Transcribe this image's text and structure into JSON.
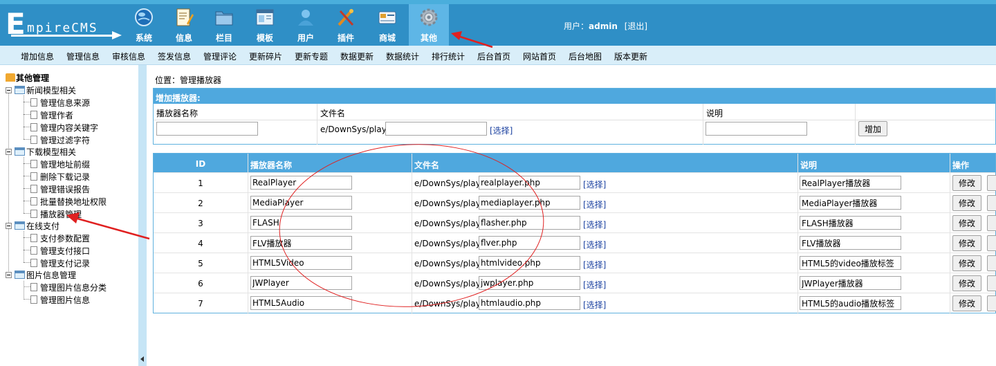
{
  "logo": {
    "first_letter": "E",
    "rest": "mpireCMS"
  },
  "nav": [
    {
      "label": "系统",
      "icon": "globe-icon"
    },
    {
      "label": "信息",
      "icon": "document-edit-icon"
    },
    {
      "label": "栏目",
      "icon": "folder-icon"
    },
    {
      "label": "模板",
      "icon": "window-icon"
    },
    {
      "label": "用户",
      "icon": "user-icon"
    },
    {
      "label": "插件",
      "icon": "tools-icon"
    },
    {
      "label": "商城",
      "icon": "card-icon"
    },
    {
      "label": "其他",
      "icon": "gear-icon",
      "active": true
    }
  ],
  "user": {
    "prefix": "用户：",
    "name": "admin",
    "logout": "[退出]"
  },
  "submenu": [
    "增加信息",
    "管理信息",
    "审核信息",
    "签发信息",
    "管理评论",
    "更新碎片",
    "更新专题",
    "数据更新",
    "数据统计",
    "排行统计",
    "后台首页",
    "网站首页",
    "后台地图",
    "版本更新"
  ],
  "tree": {
    "root": "其他管理",
    "groups": [
      {
        "label": "新闻模型相关",
        "items": [
          "管理信息来源",
          "管理作者",
          "管理内容关键字",
          "管理过滤字符"
        ]
      },
      {
        "label": "下载模型相关",
        "items": [
          "管理地址前缀",
          "删除下载记录",
          "管理错误报告",
          "批量替换地址权限",
          "播放器管理"
        ]
      },
      {
        "label": "在线支付",
        "items": [
          "支付参数配置",
          "管理支付接口",
          "管理支付记录"
        ]
      },
      {
        "label": "图片信息管理",
        "items": [
          "管理图片信息分类",
          "管理图片信息"
        ]
      }
    ]
  },
  "breadcrumb": {
    "prefix": "位置：",
    "link": "管理播放器"
  },
  "add_form": {
    "title": "增加播放器:",
    "col_name": "播放器名称",
    "col_file": "文件名",
    "col_desc": "说明",
    "path_prefix": "e/DownSys/play/",
    "select_label": "[选择]",
    "add_button": "增加"
  },
  "list": {
    "headers": {
      "id": "ID",
      "name": "播放器名称",
      "file": "文件名",
      "desc": "说明",
      "op": "操作"
    },
    "path_prefix": "e/DownSys/play/",
    "select_label": "[选择]",
    "edit_button": "修改",
    "rows": [
      {
        "id": "1",
        "name": "RealPlayer",
        "file": "realplayer.php",
        "desc": "RealPlayer播放器"
      },
      {
        "id": "2",
        "name": "MediaPlayer",
        "file": "mediaplayer.php",
        "desc": "MediaPlayer播放器"
      },
      {
        "id": "3",
        "name": "FLASH",
        "file": "flasher.php",
        "desc": "FLASH播放器"
      },
      {
        "id": "4",
        "name": "FLV播放器",
        "file": "flver.php",
        "desc": "FLV播放器"
      },
      {
        "id": "5",
        "name": "HTML5Video",
        "file": "htmlvideo.php",
        "desc": "HTML5的video播放标签"
      },
      {
        "id": "6",
        "name": "JWPlayer",
        "file": "jwplayer.php",
        "desc": "JWPlayer播放器"
      },
      {
        "id": "7",
        "name": "HTML5Audio",
        "file": "htmlaudio.php",
        "desc": "HTML5的audio播放标签"
      }
    ]
  },
  "colors": {
    "header_blue": "#2f8fc6",
    "table_header": "#4fa8de",
    "annotation_red": "#e02020"
  }
}
